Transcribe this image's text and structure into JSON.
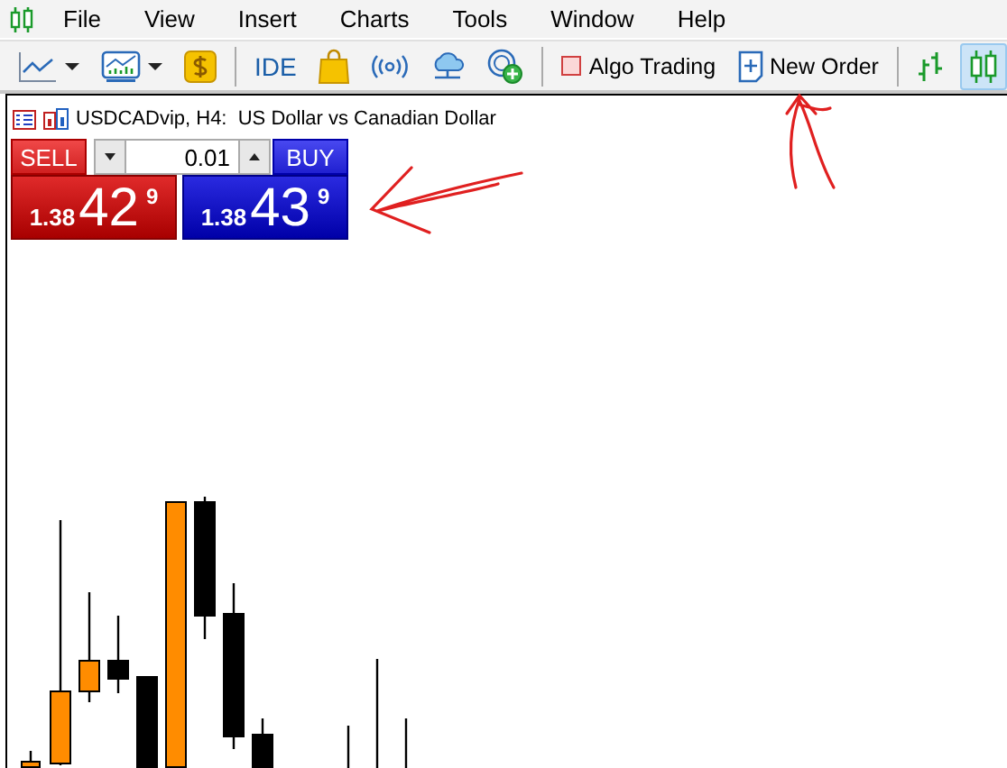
{
  "menu": [
    {
      "label": "File"
    },
    {
      "label": "View"
    },
    {
      "label": "Insert"
    },
    {
      "label": "Charts"
    },
    {
      "label": "Tools"
    },
    {
      "label": "Window"
    },
    {
      "label": "Help"
    }
  ],
  "toolbar": [
    {
      "kind": "line-chart-menu"
    },
    {
      "kind": "indicators-menu"
    },
    {
      "kind": "market"
    },
    {
      "kind": "separator"
    },
    {
      "kind": "text",
      "label": "IDE"
    },
    {
      "kind": "bag"
    },
    {
      "kind": "signals"
    },
    {
      "kind": "cloud"
    },
    {
      "kind": "vps"
    },
    {
      "kind": "separator"
    },
    {
      "kind": "algo",
      "label": "Algo Trading",
      "on": false
    },
    {
      "kind": "new-order",
      "label": "New Order"
    },
    {
      "kind": "separator"
    },
    {
      "kind": "bar-chart",
      "selected": false
    },
    {
      "kind": "candle-chart",
      "selected": true
    }
  ],
  "chart": {
    "title": "USDCADvip, H4:  US Dollar vs Canadian Dollar",
    "trade_panel": {
      "sell_label": "SELL",
      "buy_label": "BUY",
      "volume": "0.01",
      "sell_price": {
        "prefix": "1.38",
        "big": "42",
        "sup": "9"
      },
      "buy_price": {
        "prefix": "1.38",
        "big": "43",
        "sup": "9"
      }
    }
  }
}
